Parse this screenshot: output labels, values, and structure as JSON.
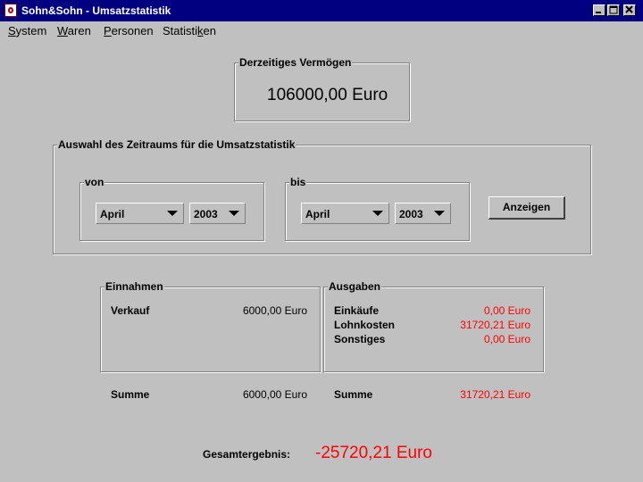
{
  "window": {
    "title": "Sohn&Sohn - Umsatzstatistik",
    "controls": [
      "minimize-icon",
      "maximize-icon",
      "close-icon"
    ]
  },
  "menu": {
    "items": [
      {
        "label": "System",
        "mnemonic": "S"
      },
      {
        "label": "Waren",
        "mnemonic": "W"
      },
      {
        "label": "Personen",
        "mnemonic": "P"
      },
      {
        "label": "Statistiken",
        "mnemonic": "k"
      }
    ]
  },
  "vermoegen": {
    "label": "Derzeitiges Vermögen",
    "value": "106000,00 Euro"
  },
  "zeitraum": {
    "label": "Auswahl des Zeitraums für die Umsatzstatistik",
    "von": {
      "label": "von",
      "month": "April",
      "year": "2003"
    },
    "bis": {
      "label": "bis",
      "month": "April",
      "year": "2003"
    },
    "button": "Anzeigen"
  },
  "einnahmen": {
    "label": "Einnahmen",
    "rows": [
      {
        "label": "Verkauf",
        "value": "6000,00 Euro"
      }
    ],
    "summe_label": "Summe",
    "summe_value": "6000,00 Euro"
  },
  "ausgaben": {
    "label": "Ausgaben",
    "rows": [
      {
        "label": "Einkäufe",
        "value": "0,00 Euro"
      },
      {
        "label": "Lohnkosten",
        "value": "31720,21 Euro"
      },
      {
        "label": "Sonstiges",
        "value": "0,00 Euro"
      }
    ],
    "summe_label": "Summe",
    "summe_value": "31720,21 Euro"
  },
  "gesamt": {
    "label": "Gesamtergebnis:",
    "value": "-25720,21 Euro"
  },
  "colors": {
    "titlebar": "#000080",
    "negative": "#ff0000",
    "background": "#c0c0c0"
  }
}
